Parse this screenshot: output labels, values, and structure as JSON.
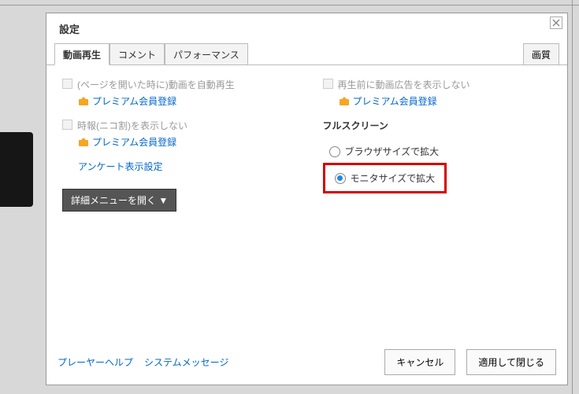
{
  "dialog": {
    "title": "設定",
    "tabs": {
      "video": "動画再生",
      "comment": "コメント",
      "performance": "パフォーマンス",
      "quality": "画質"
    },
    "left": {
      "autoplay_label": "(ページを開いた時に)動画を自動再生",
      "premium_link": "プレミアム会員登録",
      "nicowari_label": "時報(ニコ割)を表示しない",
      "survey_link": "アンケート表示設定",
      "detail_button": "詳細メニューを開く ▼"
    },
    "right": {
      "noads_label": "再生前に動画広告を表示しない",
      "premium_link": "プレミアム会員登録",
      "fullscreen_head": "フルスクリーン",
      "radio_browser": "ブラウザサイズで拡大",
      "radio_monitor": "モニタサイズで拡大"
    },
    "footer": {
      "help_link": "プレーヤーヘルプ",
      "sysmsg_link": "システムメッセージ",
      "cancel": "キャンセル",
      "apply": "適用して閉じる"
    }
  }
}
